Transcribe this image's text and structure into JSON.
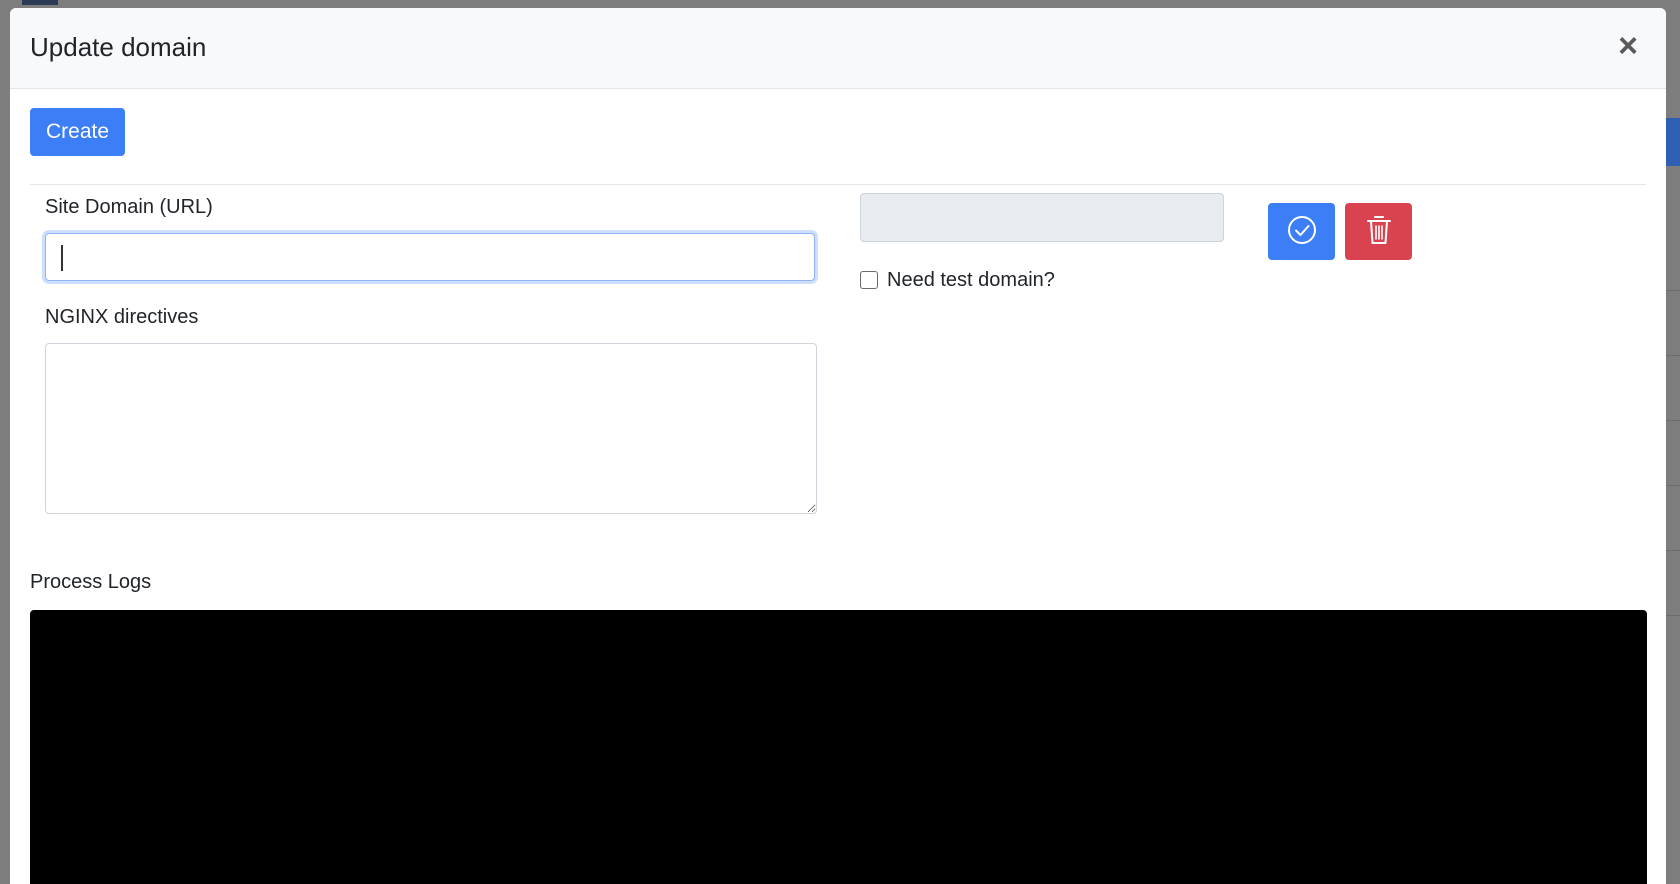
{
  "modal": {
    "title": "Update domain",
    "close_label": "×"
  },
  "toolbar": {
    "create_label": "Create"
  },
  "form": {
    "site_domain_label": "Site Domain (URL)",
    "site_domain_value": "",
    "nginx_label": "NGINX directives",
    "nginx_value": "",
    "test_domain_value": "",
    "need_test_label": "Need test domain?",
    "need_test_checked": false
  },
  "actions": {
    "confirm_icon": "check-circle-icon",
    "delete_icon": "trash-icon"
  },
  "logs": {
    "label": "Process Logs",
    "content": ""
  },
  "colors": {
    "primary": "#3b7ef6",
    "danger": "#d9434f",
    "console_bg": "#000000"
  }
}
